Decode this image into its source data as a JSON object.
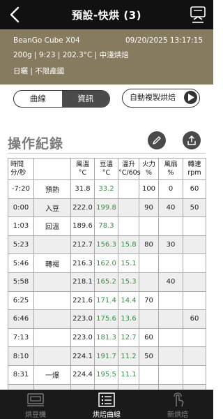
{
  "header": {
    "title": "預設-快烘 (3)"
  },
  "info": {
    "machine": "BeanGo Cube X04",
    "datetime": "09/20/2025 13:17:15",
    "stats": "200g  |  9:23  |  202.3°C  |  中淺烘焙",
    "origin": "日曬  |  不限產國"
  },
  "tabs": [
    "曲線",
    "資訊"
  ],
  "active_tab": "資訊",
  "auto_copy_label": "自動複製烘焙",
  "section_title": "操作紀錄",
  "table": {
    "headers": [
      "時間\n分/秒",
      "",
      "風溫\n°C",
      "豆溫\n°C",
      "溫升\n°C/60s",
      "火力\n%",
      "風扇\n%",
      "轉速\nrpm"
    ],
    "rows": [
      [
        "-7:20",
        "預熱",
        "31.8",
        "33.2",
        "",
        "100",
        "0",
        "60"
      ],
      [
        "0:00",
        "入豆",
        "222.0",
        "199.8",
        "",
        "90",
        "40",
        "50"
      ],
      [
        "1:03",
        "回溫",
        "189.6",
        "78.3",
        "",
        "",
        "",
        ""
      ],
      [
        "5:23",
        "",
        "212.7",
        "156.3",
        "15.8",
        "80",
        "30",
        ""
      ],
      [
        "5:46",
        "轉褐",
        "216.3",
        "162.0",
        "15.1",
        "",
        "",
        ""
      ],
      [
        "5:58",
        "",
        "218.1",
        "165.2",
        "15.3",
        "",
        "40",
        ""
      ],
      [
        "6:25",
        "",
        "221.6",
        "171.4",
        "14.4",
        "70",
        "",
        ""
      ],
      [
        "6:46",
        "",
        "223.0",
        "175.6",
        "13.6",
        "",
        "",
        "60"
      ],
      [
        "7:13",
        "",
        "223.0",
        "181.3",
        "12.7",
        "60",
        "",
        ""
      ],
      [
        "8:10",
        "",
        "224.1",
        "191.7",
        "11.2",
        "50",
        "",
        ""
      ],
      [
        "8:31",
        "一爆",
        "224.4",
        "195.5",
        "11.1",
        "",
        "",
        ""
      ],
      [
        "9:23",
        "出豆",
        "225.4",
        "202.3",
        "7.9",
        "",
        "",
        ""
      ]
    ]
  },
  "bottom_nav": [
    {
      "label": "烘豆機",
      "icon": "roaster-icon",
      "active": false
    },
    {
      "label": "烘焙曲線",
      "icon": "list-icon",
      "active": true
    },
    {
      "label": "新烘焙",
      "icon": "touch-icon",
      "active": false
    }
  ],
  "colors": {
    "info_band": "#877b5f",
    "bean_temp_green": "#3f8a4a",
    "bar": "#111111"
  }
}
